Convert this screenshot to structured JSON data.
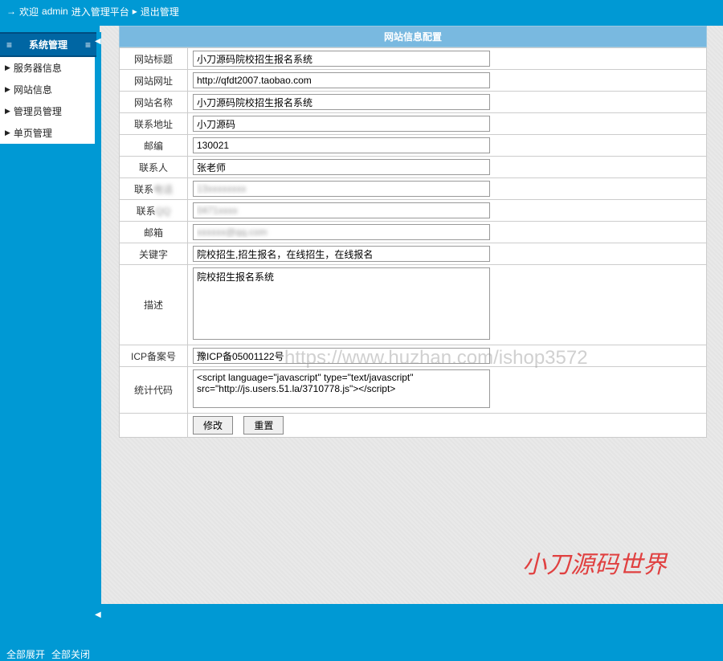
{
  "topbar": {
    "welcome": "欢迎",
    "username": "admin",
    "enter": "进入管理平台",
    "logout": "退出管理"
  },
  "sidebar": {
    "header": "系统管理",
    "items": [
      {
        "label": "服务器信息"
      },
      {
        "label": "网站信息"
      },
      {
        "label": "管理员管理"
      },
      {
        "label": "单页管理"
      }
    ]
  },
  "panel": {
    "title": "网站信息配置"
  },
  "form": {
    "site_title_lbl": "网站标题",
    "site_title": "小刀源码院校招生报名系统",
    "site_url_lbl": "网站网址",
    "site_url": "http://qfdt2007.taobao.com",
    "site_name_lbl": "网站名称",
    "site_name": "小刀源码院校招生报名系统",
    "address_lbl": "联系地址",
    "address": "小刀源码",
    "zip_lbl": "邮编",
    "zip": "130021",
    "contact_lbl": "联系人",
    "contact": "张老师",
    "phone1_lbl": "联系",
    "phone1": "13xxxxxxxx",
    "phone2_lbl": "联系",
    "phone2": "0471xxxx",
    "email_lbl": "邮箱",
    "email": "xxxxxx@qq.com",
    "keywords_lbl": "关键字",
    "keywords": "院校招生,招生报名，在线招生，在线报名",
    "desc_lbl": "描述",
    "desc": "院校招生报名系统",
    "icp_lbl": "ICP备案号",
    "icp": "豫ICP备05001122号",
    "stats_lbl": "统计代码",
    "stats": "<script language=\"javascript\" type=\"text/javascript\" src=\"http://js.users.51.la/3710778.js\"></script>"
  },
  "buttons": {
    "save": "修改",
    "reset": "重置"
  },
  "bottom": {
    "expand": "全部展开",
    "collapse": "全部关闭"
  },
  "watermarks": {
    "url": "https://www.huzhan.com/ishop3572",
    "brand": "小刀源码世界"
  }
}
